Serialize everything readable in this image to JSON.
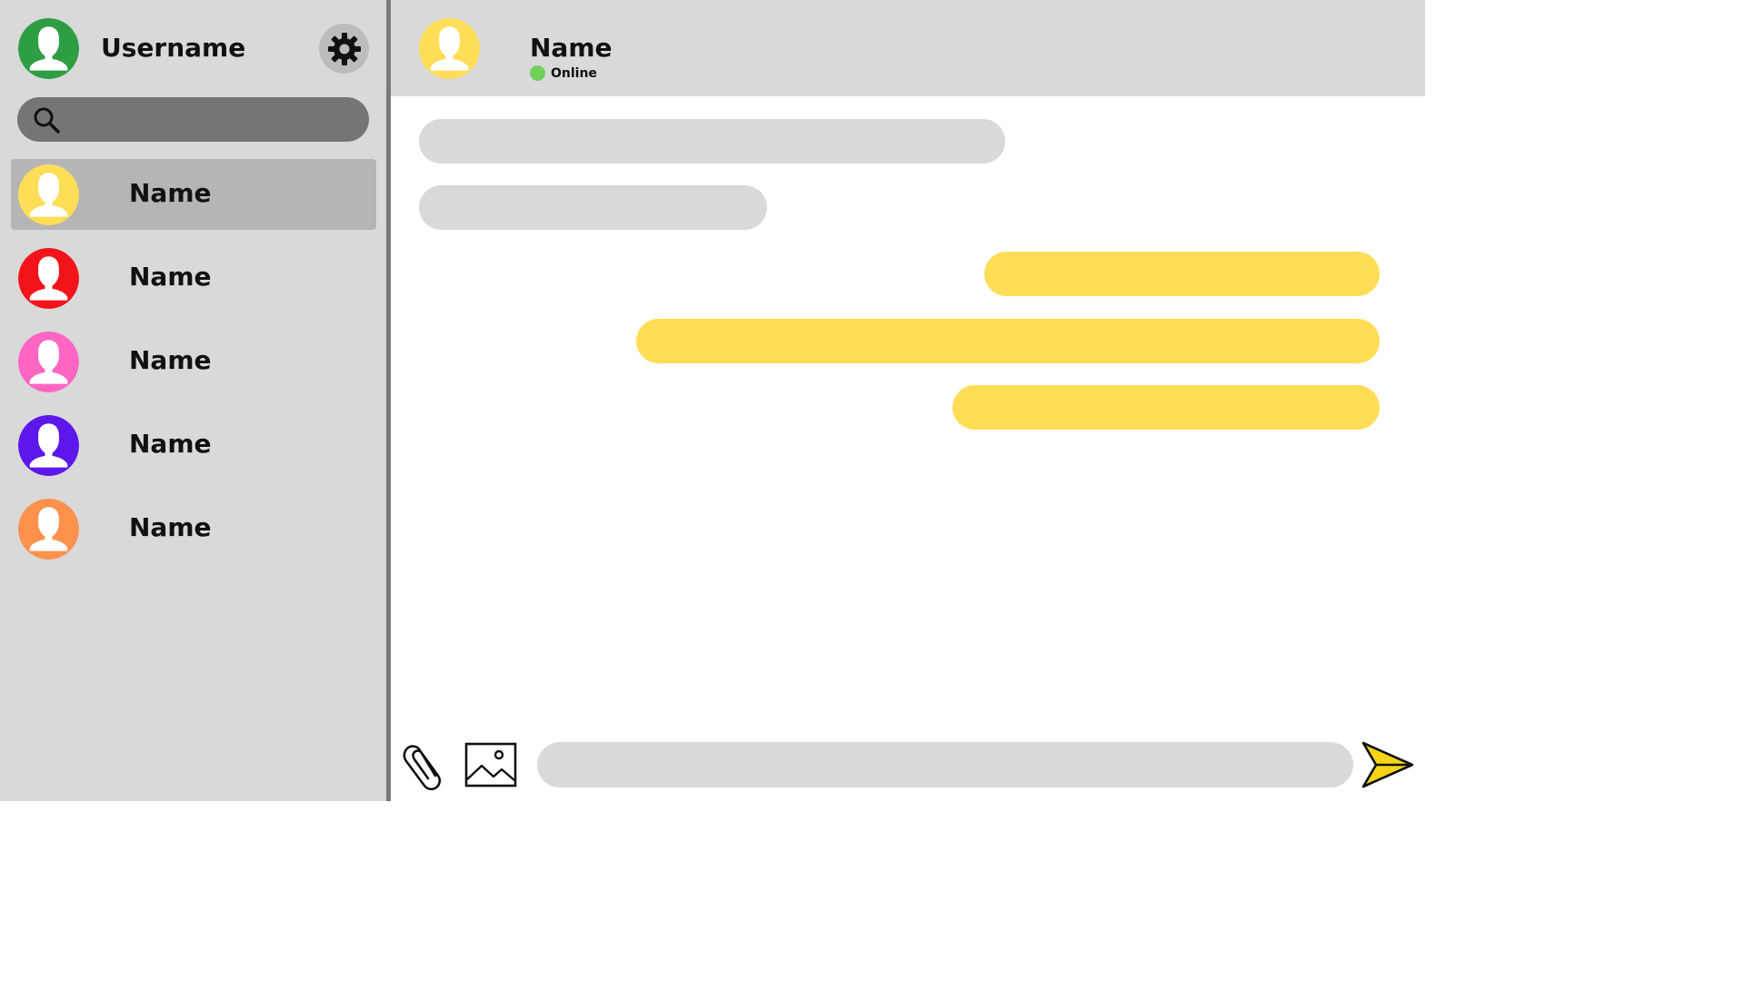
{
  "colors": {
    "panel_bg": "#d9d9d9",
    "active_item_bg": "#b5b5b5",
    "search_bg": "#757575",
    "incoming_bubble": "#d9d9d9",
    "outgoing_bubble": "#ffdd57",
    "online_dot": "#6fd15a",
    "send_icon": "#f5d418"
  },
  "sidebar": {
    "username": "Username",
    "user_avatar_color": "#2e9e44",
    "settings_icon": "gear-icon",
    "search": {
      "icon": "search-icon",
      "placeholder": ""
    },
    "contacts": [
      {
        "name": "Name",
        "avatar_color": "#ffdd57",
        "active": true
      },
      {
        "name": "Name",
        "avatar_color": "#f2141a",
        "active": false
      },
      {
        "name": "Name",
        "avatar_color": "#ff66c4",
        "active": false
      },
      {
        "name": "Name",
        "avatar_color": "#5e17eb",
        "active": false
      },
      {
        "name": "Name",
        "avatar_color": "#ff914d",
        "active": false
      }
    ]
  },
  "chat": {
    "header": {
      "name": "Name",
      "status": "Online",
      "avatar_color": "#ffdd57"
    },
    "messages": [
      {
        "direction": "incoming",
        "text": ""
      },
      {
        "direction": "incoming",
        "text": ""
      },
      {
        "direction": "outgoing",
        "text": ""
      },
      {
        "direction": "outgoing",
        "text": ""
      },
      {
        "direction": "outgoing",
        "text": ""
      }
    ],
    "composer": {
      "attach_icon": "paperclip-icon",
      "image_icon": "image-icon",
      "send_icon": "send-icon",
      "placeholder": ""
    }
  }
}
